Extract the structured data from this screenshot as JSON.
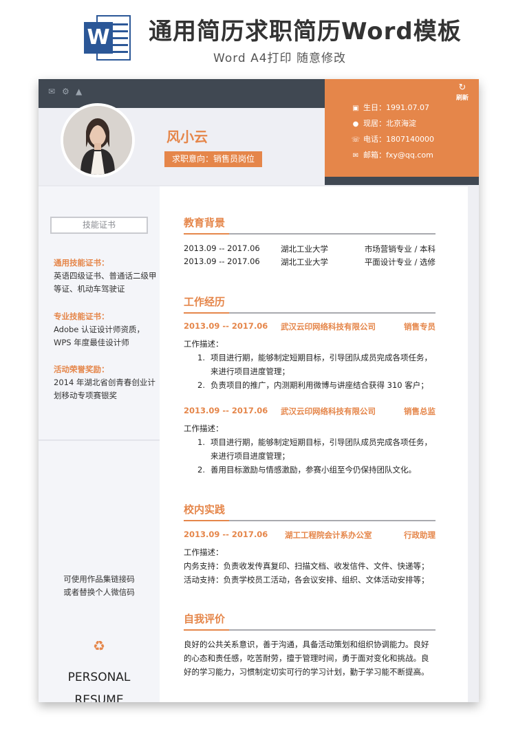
{
  "banner": {
    "icon_letter": "W",
    "title": "通用简历求职简历Word模板",
    "subtitle": "Word A4打印 随意修改"
  },
  "header": {
    "top_icons": [
      "envelope-icon",
      "gear-icon",
      "graduation-cap-icon"
    ],
    "name": "风小云",
    "intent": "求职意向：销售员岗位",
    "refresh_label": "刷新",
    "contacts": {
      "birthday": "生日：1991.07.07",
      "location": "现居：北京海淀",
      "phone": "电话：1807140000",
      "email": "邮箱：fxy@qq.com"
    }
  },
  "sidebar": {
    "skill_title": "技能证书",
    "general_key": "通用技能证书：",
    "general_val": "英语四级证书、普通话二级甲等证、机动车驾驶证",
    "pro_key": "专业技能证书：",
    "pro_val": "Adobe 认证设计师资质，WPS 年度最佳设计师",
    "award_key": "活动荣誉奖励：",
    "award_val": "2014 年湖北省创青春创业计划移动专项赛银奖",
    "qr_note_1": "可使用作品集链接码",
    "qr_note_2": "或者替换个人微信码",
    "footer_1": "PERSONAL",
    "footer_2": "RESUME"
  },
  "education": {
    "title": "教育背景",
    "rows": [
      {
        "period": "2013.09 -- 2017.06",
        "school": "湖北工业大学",
        "major": "市场营销专业 / 本科"
      },
      {
        "period": "2013.09 -- 2017.06",
        "school": "湖北工业大学",
        "major": "平面设计专业 / 选修"
      }
    ]
  },
  "work": {
    "title": "工作经历",
    "jobs": [
      {
        "period": "2013.09 -- 2017.06",
        "company": "武汉云印网络科技有限公司",
        "role": "销售专员",
        "desc_label": "工作描述：",
        "items": [
          {
            "n": "1.",
            "line1": "项目进行期，能够制定短期目标，引导团队成员完成各项任务，",
            "line2": "来进行项目进度管理；"
          },
          {
            "n": "2.",
            "line1": "负责项目的推广，内测期利用微博与讲座结合获得 310 客户；",
            "line2": ""
          }
        ]
      },
      {
        "period": "2013.09 -- 2017.06",
        "company": "武汉云印网络科技有限公司",
        "role": "销售总监",
        "desc_label": "工作描述：",
        "items": [
          {
            "n": "1.",
            "line1": "项目进行期，能够制定短期目标，引导团队成员完成各项任务，",
            "line2": "来进行项目进度管理；"
          },
          {
            "n": "2.",
            "line1": "善用目标激励与情感激励，参赛小组至今仍保持团队文化。",
            "line2": ""
          }
        ]
      }
    ]
  },
  "campus": {
    "title": "校内实践",
    "period": "2013.09 -- 2017.06",
    "org": "湖工工程院会计系办公室",
    "role": "行政助理",
    "desc_label": "工作描述：",
    "line1": "内务支持：负责收发传真复印、扫描文档、收发信件、文件、快递等；",
    "line2": "活动支持：负责学校员工活动，各会议安排、组织、文体活动安排等；"
  },
  "self": {
    "title": "自我评价",
    "line1": "良好的公共关系意识，善于沟通，具备活动策划和组织协调能力。良好",
    "line2": "的心态和责任感，吃苦耐劳，擅于管理时间，勇于面对变化和挑战。良",
    "line3": "好的学习能力，习惯制定切实可行的学习计划，勤于学习能不断提高。"
  },
  "colors": {
    "accent": "#e5864a",
    "dark": "#404852",
    "light": "#eeeff4"
  }
}
